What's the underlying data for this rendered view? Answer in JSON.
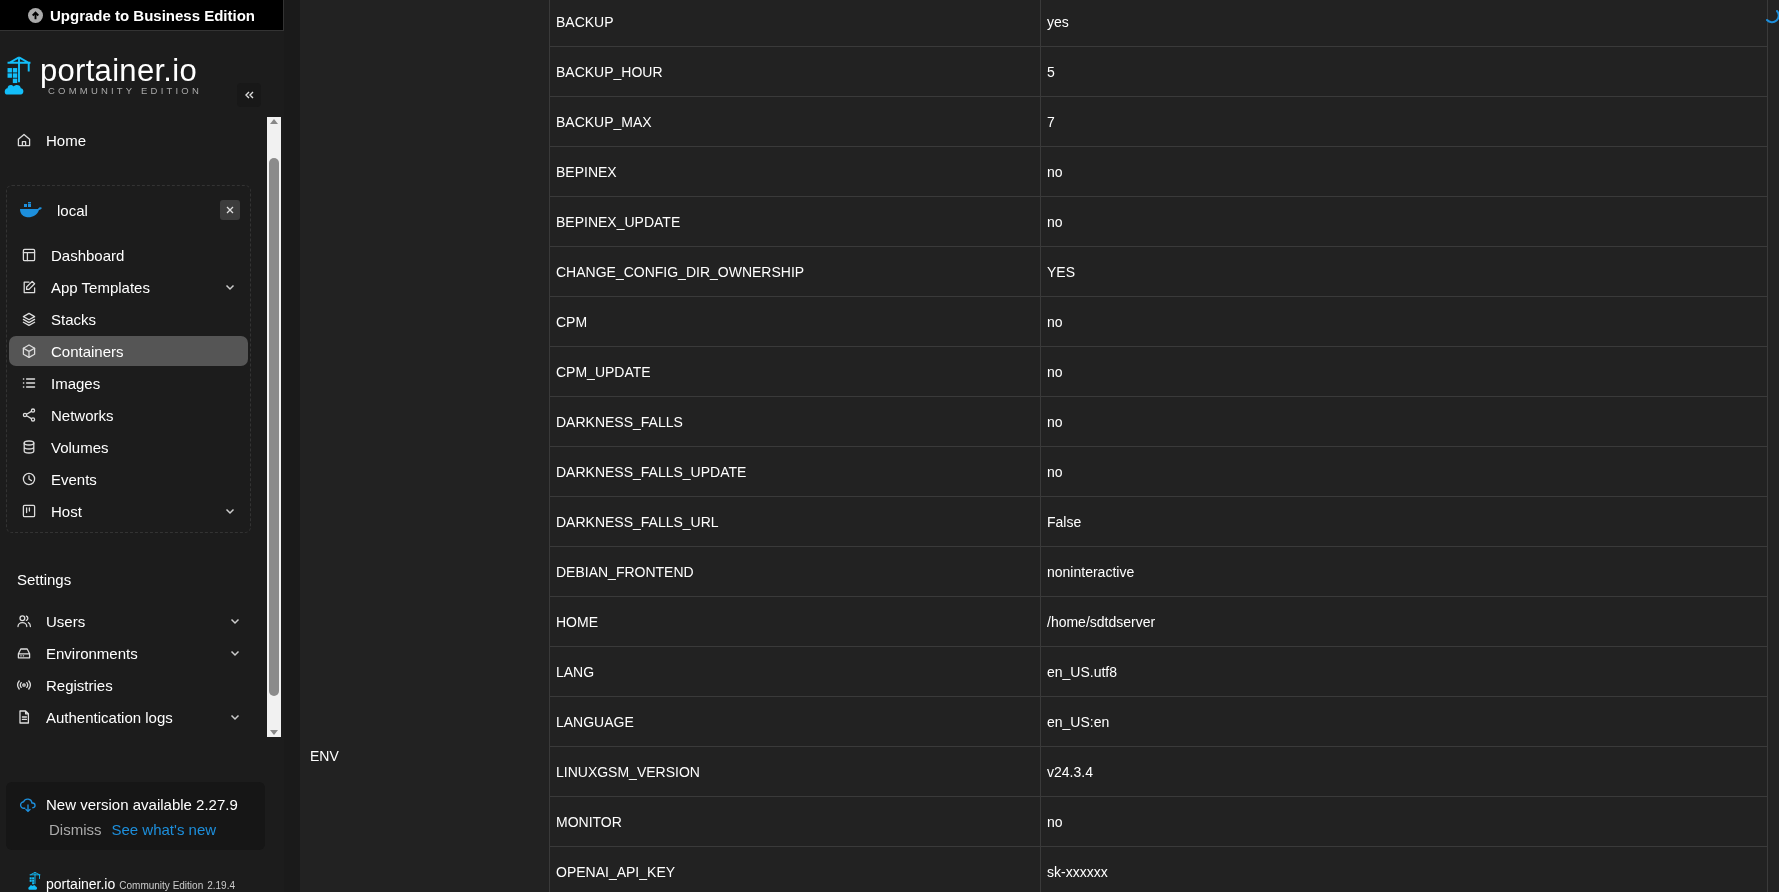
{
  "upgrade_banner": {
    "label": "Upgrade to Business Edition"
  },
  "sidebar": {
    "brand": {
      "name": "portainer.io",
      "edition": "COMMUNITY EDITION"
    },
    "home": {
      "label": "Home"
    },
    "environment": {
      "name": "local",
      "items": [
        {
          "label": "Dashboard",
          "expandable": false,
          "selected": false
        },
        {
          "label": "App Templates",
          "expandable": true,
          "selected": false
        },
        {
          "label": "Stacks",
          "expandable": false,
          "selected": false
        },
        {
          "label": "Containers",
          "expandable": false,
          "selected": true
        },
        {
          "label": "Images",
          "expandable": false,
          "selected": false
        },
        {
          "label": "Networks",
          "expandable": false,
          "selected": false
        },
        {
          "label": "Volumes",
          "expandable": false,
          "selected": false
        },
        {
          "label": "Events",
          "expandable": false,
          "selected": false
        },
        {
          "label": "Host",
          "expandable": true,
          "selected": false
        }
      ]
    },
    "settings": {
      "title": "Settings",
      "items": [
        {
          "label": "Users",
          "expandable": true
        },
        {
          "label": "Environments",
          "expandable": true
        },
        {
          "label": "Registries",
          "expandable": false
        },
        {
          "label": "Authentication logs",
          "expandable": true
        }
      ]
    },
    "update_notice": {
      "message": "New version available 2.27.9",
      "dismiss": "Dismiss",
      "link": "See what's new"
    },
    "footer": {
      "brand": "portainer.io",
      "edition": "Community Edition",
      "version": "2.19.4"
    }
  },
  "table": {
    "group_label": "ENV",
    "rows": [
      {
        "key": "BACKUP",
        "value": "yes"
      },
      {
        "key": "BACKUP_HOUR",
        "value": "5"
      },
      {
        "key": "BACKUP_MAX",
        "value": "7"
      },
      {
        "key": "BEPINEX",
        "value": "no"
      },
      {
        "key": "BEPINEX_UPDATE",
        "value": "no"
      },
      {
        "key": "CHANGE_CONFIG_DIR_OWNERSHIP",
        "value": "YES"
      },
      {
        "key": "CPM",
        "value": "no"
      },
      {
        "key": "CPM_UPDATE",
        "value": "no"
      },
      {
        "key": "DARKNESS_FALLS",
        "value": "no"
      },
      {
        "key": "DARKNESS_FALLS_UPDATE",
        "value": "no"
      },
      {
        "key": "DARKNESS_FALLS_URL",
        "value": "False"
      },
      {
        "key": "DEBIAN_FRONTEND",
        "value": "noninteractive"
      },
      {
        "key": "HOME",
        "value": "/home/sdtdserver"
      },
      {
        "key": "LANG",
        "value": "en_US.utf8"
      },
      {
        "key": "LANGUAGE",
        "value": "en_US:en"
      },
      {
        "key": "LINUXGSM_VERSION",
        "value": "v24.3.4"
      },
      {
        "key": "MONITOR",
        "value": "no"
      },
      {
        "key": "OPENAI_API_KEY",
        "value": "sk-xxxxxx"
      }
    ]
  }
}
